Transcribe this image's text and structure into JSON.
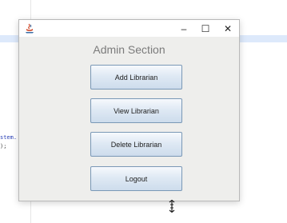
{
  "window": {
    "heading": "Admin Section",
    "controls": {
      "minimize": "–",
      "maximize": "☐",
      "close": "✕"
    }
  },
  "buttons": [
    {
      "label": "Add Librarian"
    },
    {
      "label": "View Librarian"
    },
    {
      "label": "Delete Librarian"
    },
    {
      "label": "Logout"
    }
  ],
  "background_code": {
    "line1": "stem.",
    "line2": ");"
  },
  "colors": {
    "button_border": "#7a98b6",
    "heading": "#7b7b7b",
    "window_bg": "#eeeeec"
  }
}
